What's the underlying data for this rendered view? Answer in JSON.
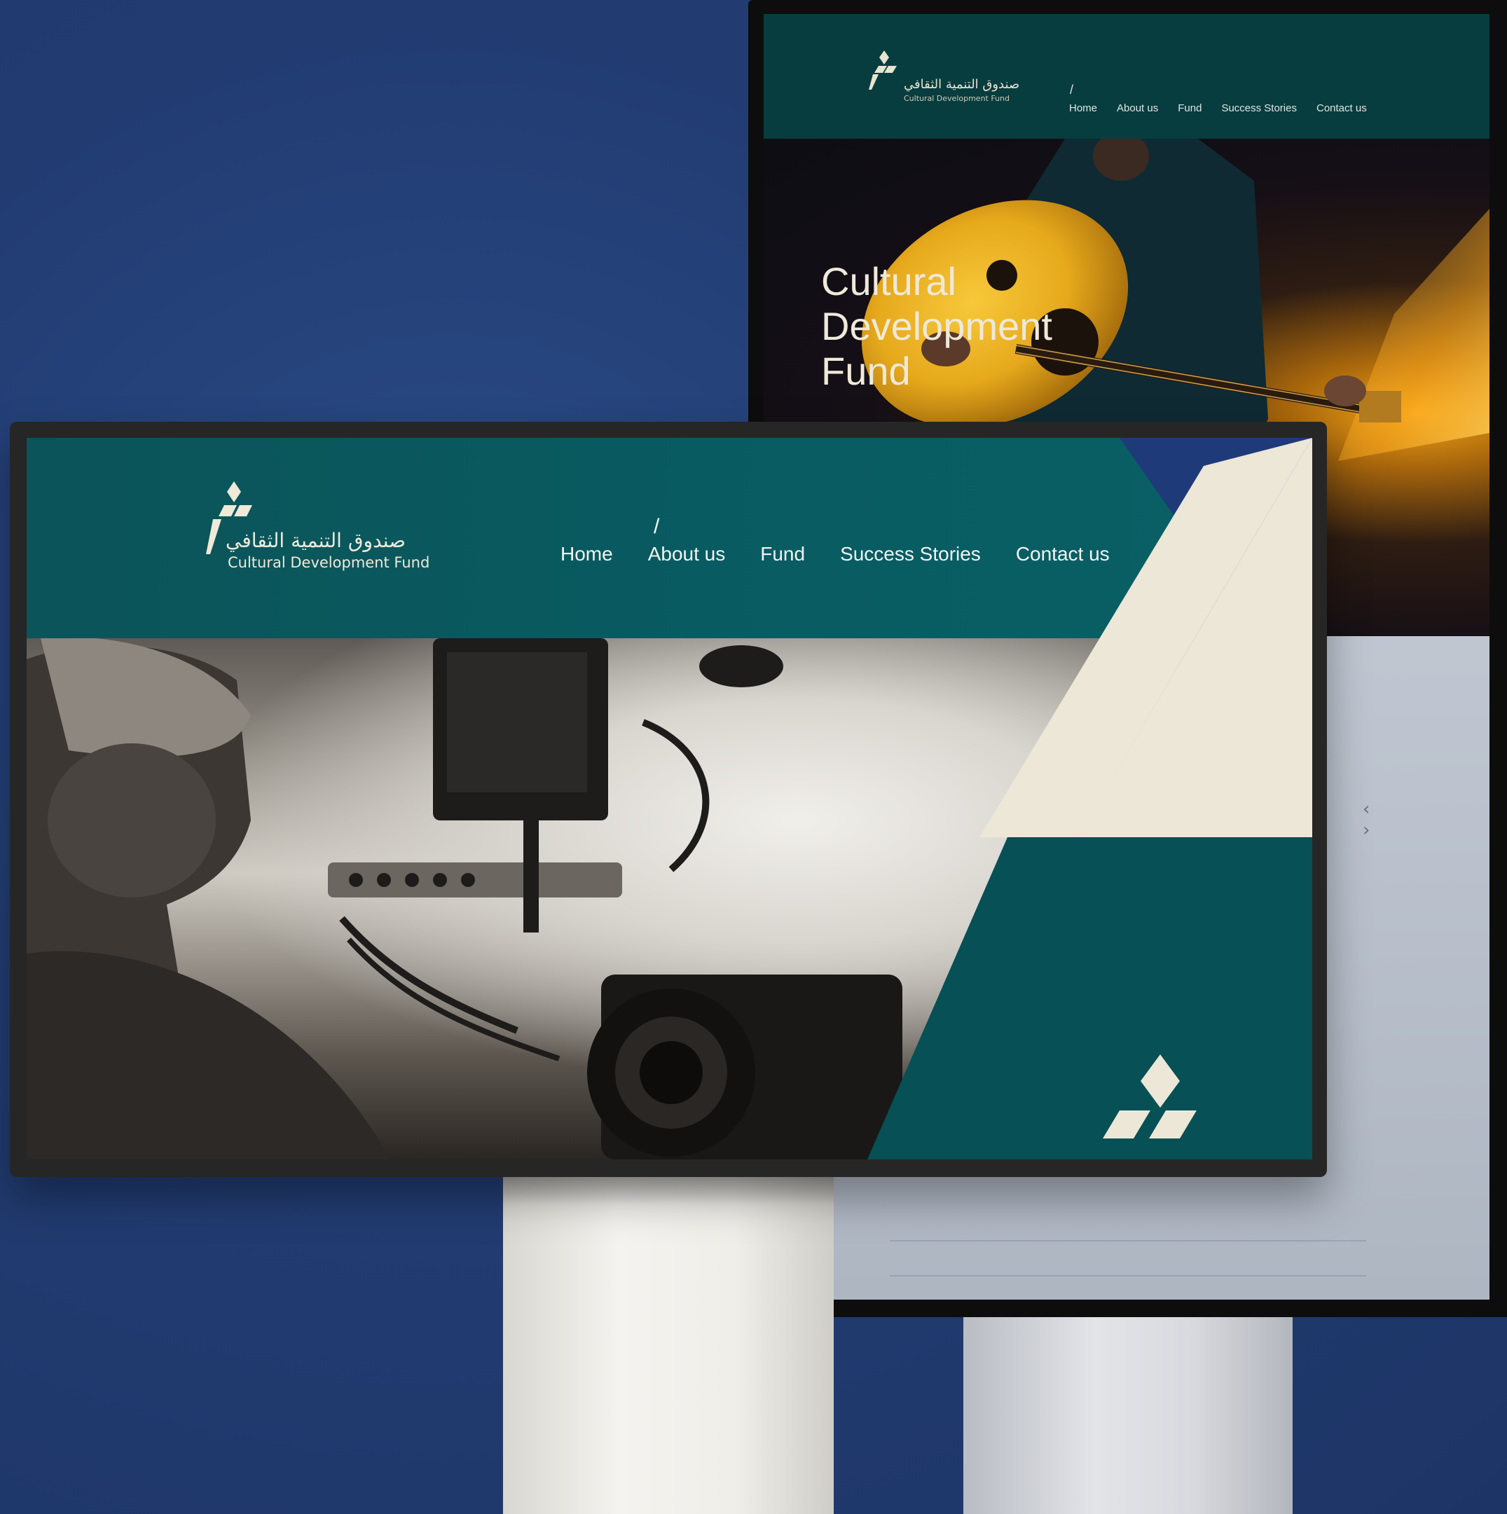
{
  "brand": {
    "name_ar": "صندوق التنمية الثقافي",
    "name_en": "Cultural Development Fund"
  },
  "nav": {
    "active_marker": "/",
    "items": [
      {
        "label": "Home"
      },
      {
        "label": "About us"
      },
      {
        "label": "Fund"
      },
      {
        "label": "Success Stories"
      },
      {
        "label": "Contact us"
      }
    ]
  },
  "back_site": {
    "hero_title_lines": [
      "Cultural",
      "Development",
      "Fund"
    ],
    "carousel": {
      "prev_glyph": "‹",
      "next_glyph": "›"
    }
  },
  "colors": {
    "background": "#223c72",
    "header_teal": "#085c62",
    "header_dark_teal": "#073d3e",
    "cream": "#efe9d8",
    "navy": "#1f3a78"
  }
}
